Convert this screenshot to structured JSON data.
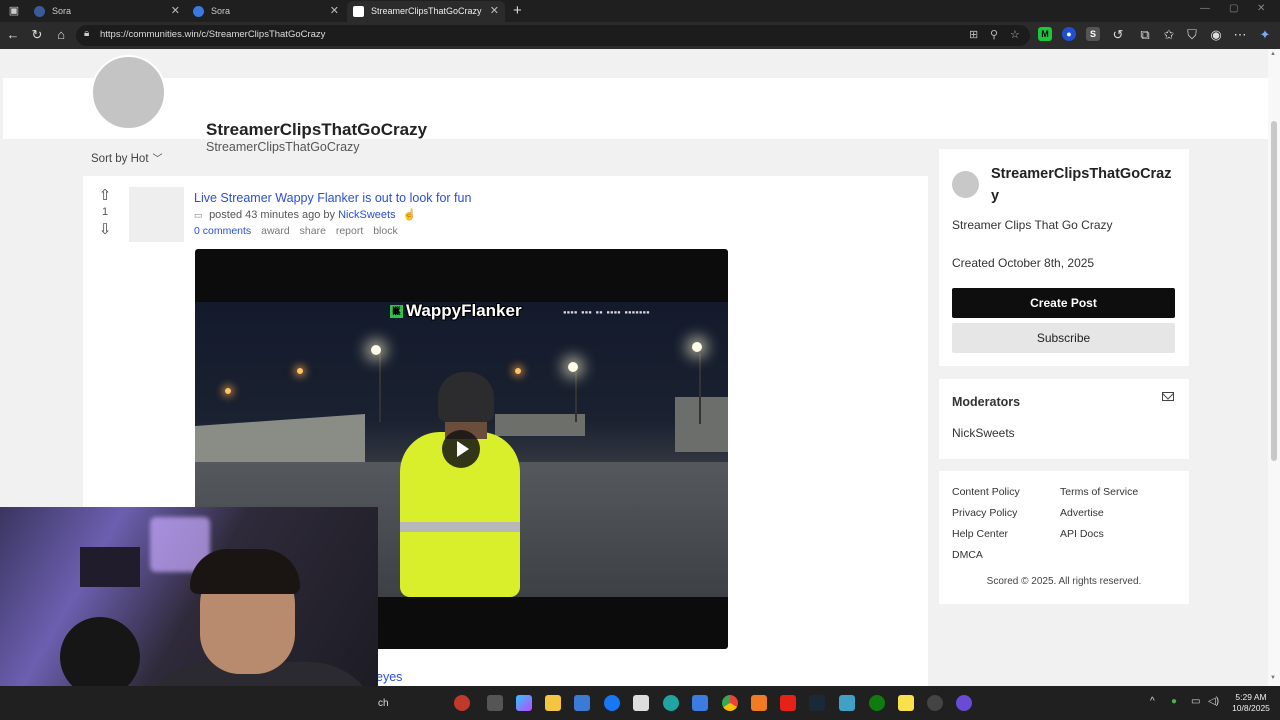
{
  "browser": {
    "tabs": [
      {
        "label": "Sora",
        "active": false
      },
      {
        "label": "Sora",
        "active": false
      },
      {
        "label": "StreamerClipsThatGoCrazy",
        "active": true
      }
    ],
    "url": "https://communities.win/c/StreamerClipsThatGoCrazy"
  },
  "community": {
    "title": "StreamerClipsThatGoCrazy",
    "subtitle": "StreamerClipsThatGoCrazy"
  },
  "sort": {
    "label": "Sort by Hot"
  },
  "post": {
    "votes": "1",
    "title": "Live Streamer Wappy Flanker is out to look for fun",
    "meta_prefix": "posted 43 minutes ago by",
    "author": "NickSweets",
    "actions": {
      "comments": "0 comments",
      "award": "award",
      "share": "share",
      "report": "report",
      "block": "block"
    },
    "video_overlay": "WappyFlanker",
    "video_overlay_badge": "K"
  },
  "next_post": {
    "title_fragment": "eyes"
  },
  "sidebar": {
    "about": {
      "name": "StreamerClipsThatGoCrazy",
      "description": "Streamer Clips That Go Crazy",
      "created": "Created October 8th, 2025",
      "create_post_label": "Create Post",
      "subscribe_label": "Subscribe"
    },
    "moderators": {
      "title": "Moderators",
      "names": [
        "NickSweets"
      ]
    },
    "footer": {
      "links": [
        "Content Policy",
        "Terms of Service",
        "Privacy Policy",
        "Advertise",
        "Help Center",
        "API Docs",
        "DMCA"
      ],
      "copyright": "Scored © 2025. All rights reserved."
    }
  },
  "taskbar": {
    "search_fragment": "ch",
    "time": "5:29 AM",
    "date": "10/8/2025"
  },
  "colors": {
    "link": "#2a4fd6",
    "create_button": "#0e0e0e",
    "subscribe_button": "#e6e6e6",
    "page_bg": "#f1f1f1"
  }
}
